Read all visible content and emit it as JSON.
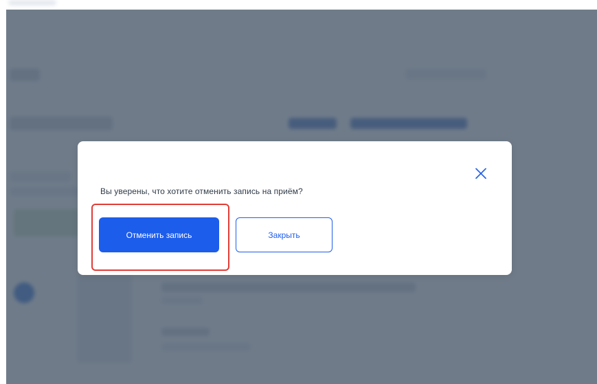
{
  "dialog": {
    "message": "Вы уверены, что хотите отменить запись на приём?",
    "confirm_label": "Отменить запись",
    "close_label": "Закрыть",
    "close_icon": "close-icon"
  },
  "colors": {
    "primary": "#1d5deb",
    "overlay": "#475668",
    "highlight": "#e23b35",
    "text": "#2f3a47"
  }
}
